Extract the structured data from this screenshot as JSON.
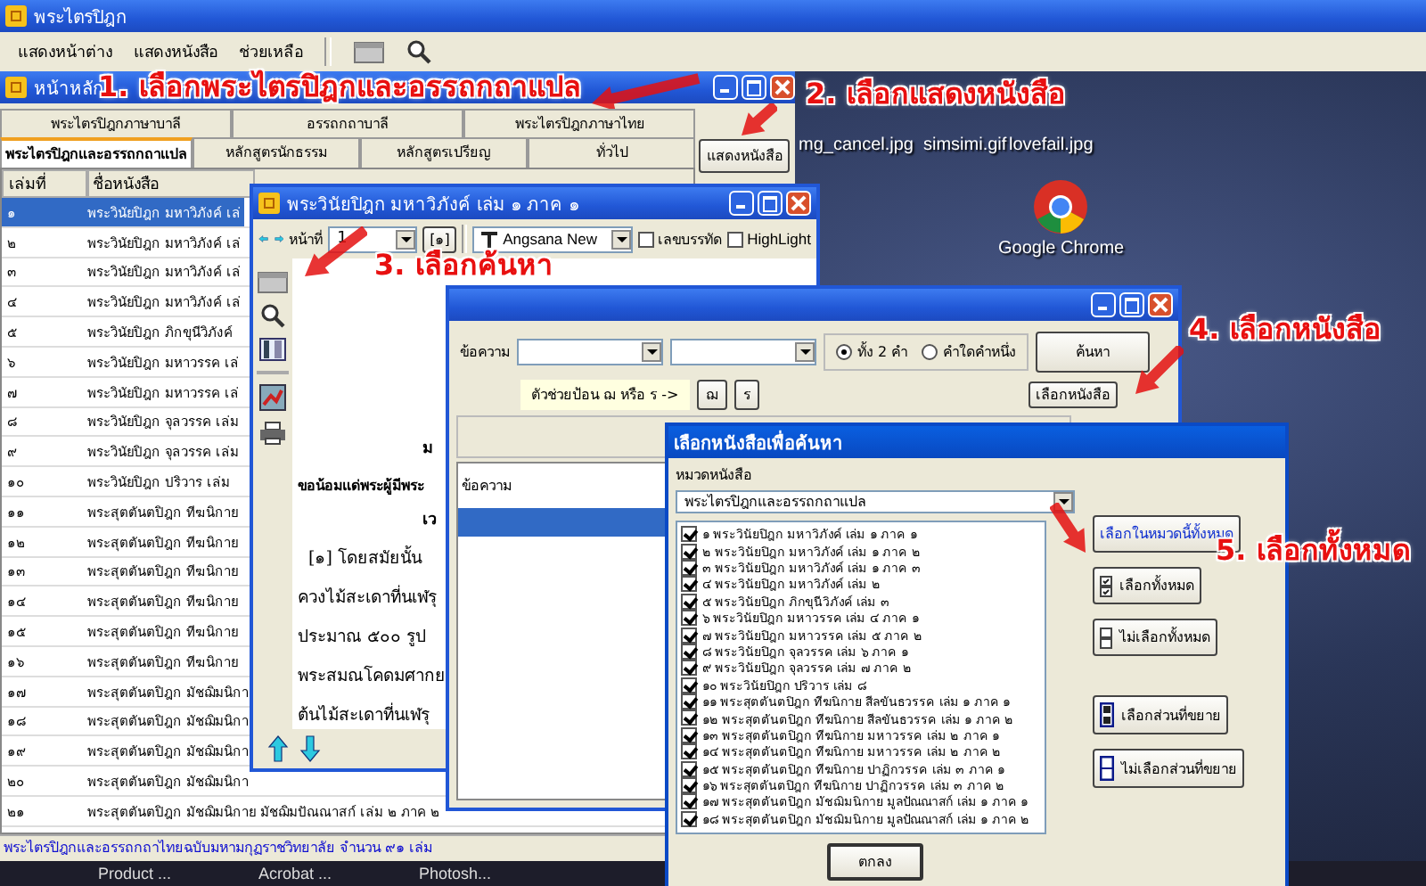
{
  "app": {
    "title": "พระไตรปิฎก",
    "menu": [
      "แสดงหน้าต่าง",
      "แสดงหนังสือ",
      "ช่วยเหลือ"
    ]
  },
  "main_window": {
    "title": "หน้าหลัก",
    "tab_rows": [
      [
        {
          "label": "พระไตรปิฎกภาษาบาลี",
          "selected": false
        },
        {
          "label": "อรรถกถาบาลี",
          "selected": false
        },
        {
          "label": "พระไตรปิฎกภาษาไทย",
          "selected": false
        }
      ],
      [
        {
          "label": "พระไตรปิฎกและอรรถกถาแปล",
          "selected": true
        },
        {
          "label": "หลักสูตรนักธรรม",
          "selected": false
        },
        {
          "label": "หลักสูตรเปรียญ",
          "selected": false
        },
        {
          "label": "ทั่วไป",
          "selected": false
        }
      ]
    ],
    "columns": [
      "เล่มที่",
      "ชื่อหนังสือ"
    ],
    "rows": [
      {
        "number": "๑",
        "name": "พระวินัยปิฎก มหาวิภังค์ เล่",
        "selected": true
      },
      {
        "number": "๒",
        "name": "พระวินัยปิฎก มหาวิภังค์ เล่",
        "selected": false
      },
      {
        "number": "๓",
        "name": "พระวินัยปิฎก มหาวิภังค์ เล่",
        "selected": false
      },
      {
        "number": "๔",
        "name": "พระวินัยปิฎก มหาวิภังค์ เล่",
        "selected": false
      },
      {
        "number": "๕",
        "name": "พระวินัยปิฎก ภิกขุนีวิภังค์",
        "selected": false
      },
      {
        "number": "๖",
        "name": "พระวินัยปิฎก มหาวรรค เล่",
        "selected": false
      },
      {
        "number": "๗",
        "name": "พระวินัยปิฎก มหาวรรค เล่",
        "selected": false
      },
      {
        "number": "๘",
        "name": "พระวินัยปิฎก จุลวรรค เล่ม",
        "selected": false
      },
      {
        "number": "๙",
        "name": "พระวินัยปิฎก จุลวรรค เล่ม",
        "selected": false
      },
      {
        "number": "๑๐",
        "name": "พระวินัยปิฎก ปริวาร เล่ม",
        "selected": false
      },
      {
        "number": "๑๑",
        "name": "พระสุตตันตปิฎก ทีฆนิกาย",
        "selected": false
      },
      {
        "number": "๑๒",
        "name": "พระสุตตันตปิฎก ทีฆนิกาย",
        "selected": false
      },
      {
        "number": "๑๓",
        "name": "พระสุตตันตปิฎก ทีฆนิกาย",
        "selected": false
      },
      {
        "number": "๑๔",
        "name": "พระสุตตันตปิฎก ทีฆนิกาย",
        "selected": false
      },
      {
        "number": "๑๕",
        "name": "พระสุตตันตปิฎก ทีฆนิกาย",
        "selected": false
      },
      {
        "number": "๑๖",
        "name": "พระสุตตันตปิฎก ทีฆนิกาย",
        "selected": false
      },
      {
        "number": "๑๗",
        "name": "พระสุตตันตปิฎก มัชฌิมนิกา",
        "selected": false
      },
      {
        "number": "๑๘",
        "name": "พระสุตตันตปิฎก มัชฌิมนิกา",
        "selected": false
      },
      {
        "number": "๑๙",
        "name": "พระสุตตันตปิฎก มัชฌิมนิกา",
        "selected": false
      },
      {
        "number": "๒๐",
        "name": "พระสุตตันตปิฎก มัชฌิมนิกา",
        "selected": false
      },
      {
        "number": "๒๑",
        "name": "พระสุตตันตปิฎก มัชฌิมนิกาย มัชฌิมปัณณาสก์ เล่ม ๒ ภาค ๒",
        "selected": false
      }
    ],
    "show_book_button": "แสดงหนังสือ",
    "status": "พระไตรปิฎกและอรรถกถาไทยฉบับมหามกุฏราชวิทยาลัย จำนวน ๙๑ เล่ม"
  },
  "desktop_icons": [
    {
      "label": "mg_cancel.jpg"
    },
    {
      "label": "simsimi.gif"
    },
    {
      "label": "lovefail.jpg"
    },
    {
      "label": "Google Chrome"
    }
  ],
  "book_window": {
    "title": "พระวินัยปิฎก มหาวิภังค์ เล่ม ๑ ภาค ๑",
    "page_label": "หน้าที่",
    "page": "1",
    "volume_button": "[๑]",
    "font": "Angsana New",
    "options": [
      {
        "label": "เลขบรรทัด",
        "checked": false
      },
      {
        "label": "HighLight",
        "checked": false
      }
    ],
    "text": [
      {
        "kind": "heading",
        "text": "ม"
      },
      {
        "kind": "bold",
        "text": "ขอน้อมแด่พระผู้มีพระ"
      },
      {
        "kind": "heading",
        "text": "เว"
      },
      {
        "kind": "indent",
        "text": "[๑] โดยสมัยนั้น"
      },
      {
        "kind": "line",
        "text": "ควงไม้สะเดาที่นเฬรุ"
      },
      {
        "kind": "line",
        "text": "ประมาณ ๕๐๐ รูป"
      },
      {
        "kind": "line",
        "text": "พระสมณโคดมศากย"
      },
      {
        "kind": "line",
        "text": "ต้นไม้สะเดาที่นเฬรุ"
      }
    ]
  },
  "search_window": {
    "field_label": "ข้อความ",
    "modes": [
      {
        "label": "ทั้ง 2 คำ",
        "selected": true
      },
      {
        "label": "คำใดคำหนึ่ง",
        "selected": false
      }
    ],
    "search_button": "ค้นหา",
    "hint": "ตัวช่วยป้อน ฌ หรือ ร ->",
    "helper_keys": [
      "ฌ",
      "ร"
    ],
    "choose_books_button": "เลือกหนังสือ",
    "results_header": "ข้อความ"
  },
  "select_dialog": {
    "title": "เลือกหนังสือเพื่อค้นหา",
    "category_label": "หมวดหนังสือ",
    "category": "พระไตรปิฎกและอรรถกถาแปล",
    "books": [
      {
        "label": "๑ พระวินัยปิฎก มหาวิภังค์ เล่ม ๑ ภาค ๑",
        "checked": true
      },
      {
        "label": "๒ พระวินัยปิฎก มหาวิภังค์ เล่ม ๑ ภาค ๒",
        "checked": true
      },
      {
        "label": "๓ พระวินัยปิฎก มหาวิภังค์ เล่ม ๑ ภาค ๓",
        "checked": true
      },
      {
        "label": "๔ พระวินัยปิฎก มหาวิภังค์ เล่ม ๒",
        "checked": true
      },
      {
        "label": "๕ พระวินัยปิฎก ภิกขุนีวิภังค์ เล่ม ๓",
        "checked": true
      },
      {
        "label": "๖ พระวินัยปิฎก มหาวรรค เล่ม ๔ ภาค ๑",
        "checked": true
      },
      {
        "label": "๗ พระวินัยปิฎก มหาวรรค เล่ม ๕ ภาค ๒",
        "checked": true
      },
      {
        "label": "๘ พระวินัยปิฎก จุลวรรค เล่ม ๖ ภาค ๑",
        "checked": true
      },
      {
        "label": "๙ พระวินัยปิฎก จุลวรรค เล่ม ๗ ภาค ๒",
        "checked": true
      },
      {
        "label": "๑๐ พระวินัยปิฎก ปริวาร เล่ม ๘",
        "checked": true
      },
      {
        "label": "๑๑ พระสุตตันตปิฎก ทีฆนิกาย สีลขันธวรรค เล่ม ๑ ภาค ๑",
        "checked": true
      },
      {
        "label": "๑๒ พระสุตตันตปิฎก ทีฆนิกาย สีลขันธวรรค เล่ม ๑ ภาค ๒",
        "checked": true
      },
      {
        "label": "๑๓ พระสุตตันตปิฎก ทีฆนิกาย มหาวรรค เล่ม ๒ ภาค ๑",
        "checked": true
      },
      {
        "label": "๑๔ พระสุตตันตปิฎก ทีฆนิกาย มหาวรรค เล่ม ๒ ภาค ๒",
        "checked": true
      },
      {
        "label": "๑๕ พระสุตตันตปิฎก ทีฆนิกาย ปาฏิกวรรค เล่ม ๓ ภาค ๑",
        "checked": true
      },
      {
        "label": "๑๖ พระสุตตันตปิฎก ทีฆนิกาย ปาฏิกวรรค เล่ม ๓ ภาค ๒",
        "checked": true
      },
      {
        "label": "๑๗ พระสุตตันตปิฎก มัชฌิมนิกาย มูลปัณณาสก์ เล่ม ๑ ภาค ๑",
        "checked": true
      },
      {
        "label": "๑๘ พระสุตตันตปิฎก มัชฌิมนิกาย มูลปัณณาสก์ เล่ม ๑ ภาค ๒",
        "checked": true
      }
    ],
    "side_buttons": [
      {
        "kind": "link",
        "label": "เลือกในหมวดนี้ทั้งหมด"
      },
      {
        "kind": "all",
        "label": "เลือกทั้งหมด"
      },
      {
        "kind": "none",
        "label": "ไม่เลือกทั้งหมด"
      },
      {
        "kind": "expand",
        "label": "เลือกส่วนที่ขยาย"
      },
      {
        "kind": "unexpand",
        "label": "ไม่เลือกส่วนที่ขยาย"
      }
    ],
    "ok_button": "ตกลง"
  },
  "annotations": [
    "1. เลือกพระไตรปิฎกและอรรถกถาแปล",
    "2. เลือกแสดงหนังสือ",
    "3. เลือกค้นหา",
    "4. เลือกหนังสือ",
    "5. เลือกทั้งหมด"
  ],
  "taskbar": [
    "Product ...",
    "Acrobat ...",
    "Photosh..."
  ]
}
